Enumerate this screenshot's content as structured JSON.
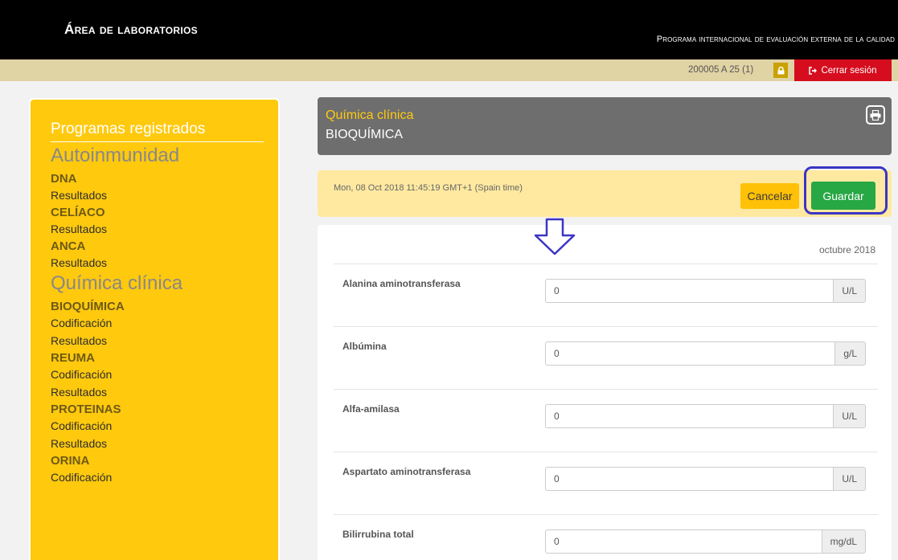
{
  "header": {
    "app_title": "Área de laboratorios",
    "program_title": "Programa internacional de evaluación externa de la calidad"
  },
  "userbar": {
    "user_code": "200005 A 25 (1)",
    "logout_label": "Cerrar sesión",
    "icons": [
      "lock-icon",
      "logout-icon"
    ]
  },
  "sidebar": {
    "heading": "Programas registrados",
    "groups": [
      {
        "name": "Autoinmunidad",
        "programs": [
          {
            "name": "DNA",
            "links": [
              "Resultados"
            ]
          },
          {
            "name": "CELÍACO",
            "links": [
              "Resultados"
            ]
          },
          {
            "name": "ANCA",
            "links": [
              "Resultados"
            ]
          }
        ]
      },
      {
        "name": "Química clínica",
        "programs": [
          {
            "name": "BIOQUÍMICA",
            "links": [
              "Codificación",
              "Resultados"
            ]
          },
          {
            "name": "REUMA",
            "links": [
              "Codificación",
              "Resultados"
            ]
          },
          {
            "name": "PROTEINAS",
            "links": [
              "Codificación",
              "Resultados"
            ]
          },
          {
            "name": "ORINA",
            "links": [
              "Codificación"
            ]
          }
        ]
      }
    ]
  },
  "panel": {
    "subtitle": "Química clínica",
    "title": "BIOQUÍMICA",
    "print_icon": "print-icon"
  },
  "infobar": {
    "timestamp": "Mon, 08 Oct 2018 11:45:19 GMT+1 (Spain time)",
    "cancel_label": "Cancelar",
    "save_label": "Guardar"
  },
  "form": {
    "period": "octubre 2018",
    "rows": [
      {
        "label": "Alanina aminotransferasa",
        "value": "0",
        "unit": "U/L"
      },
      {
        "label": "Albúmina",
        "value": "0",
        "unit": "g/L"
      },
      {
        "label": "Alfa-amilasa",
        "value": "0",
        "unit": "U/L"
      },
      {
        "label": "Aspartato aminotransferasa",
        "value": "0",
        "unit": "U/L"
      },
      {
        "label": "Bilirrubina total",
        "value": "0",
        "unit": "mg/dL"
      }
    ]
  },
  "colors": {
    "accent": "#ffc90e",
    "save": "#28a745",
    "logout": "#d60d1e",
    "annotation": "#3b35c4"
  }
}
